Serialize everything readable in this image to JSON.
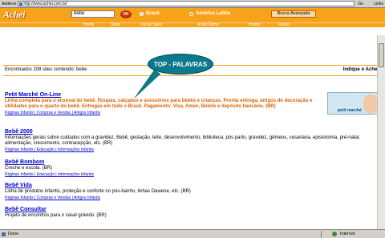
{
  "browser": {
    "address_label": "Address",
    "url": "http://www.achei.com.br/",
    "go_label": "Go",
    "links_label": "Links"
  },
  "site": {
    "logo": "Achei",
    "search_value": "bebe",
    "ok_label": "OK",
    "radio_brasil": "Brasil",
    "radio_america": "América Latina",
    "advanced_search": "Busca Avançada",
    "nav": [
      "Home",
      "Shop",
      "Incluir Sites",
      "Achei Ótimo",
      "Humor",
      "Tempo"
    ]
  },
  "results_bar": {
    "found_text": "Encontrados 208 sites contendo: bebe",
    "indique": "Indique o Achei"
  },
  "callout": "TOP - PALAVRAS",
  "results": [
    {
      "title": "Petit Marché On-Line",
      "desc": "Linha completa para o enxoval do bebê. Roupas, calçados e acessórios para bebês e crianças. Pronta entrega, artigos de decoração e utilidades para o quarto do bebê. Entregas em todo o Brasil. Pagamento: Visa, Amex, Boleto e depósito bancário. (BR)",
      "category": "Páginas Infantis | Compras e Vendas | Artigos Infantis"
    },
    {
      "title": "Bebê 2000",
      "desc": "Informações gerais sobre cuidados com a gravidez, Bebê, gestação, leite, desenvolvimento, biblioteca, pós parto, gravidez, gêmeos, cesariana, episiotomia, pré-natal, alimentação, crescimento, contracepção, etc. (BR)",
      "category": "Páginas Infantis | Educação | Informações Infantis"
    },
    {
      "title": "Bebê Bombom",
      "desc": "Creche e escola. (BR)",
      "category": "Páginas Infantis | Educação | Informações Infantis"
    },
    {
      "title": "Bebê Vida",
      "desc": "Linha de produtos infantis, proteção e conforte no pós-banho, linhas Dawene, etc. (BR)",
      "category": "Páginas Infantis | Compras e Vendas | Artigos Infantis"
    },
    {
      "title": "Bebê Consultar",
      "desc": "Projeto de encontros para o casal grávido. (BR)",
      "category": ""
    }
  ],
  "thumbnail_text": "petit marché",
  "status": {
    "left": "Done",
    "right": "Internet"
  }
}
